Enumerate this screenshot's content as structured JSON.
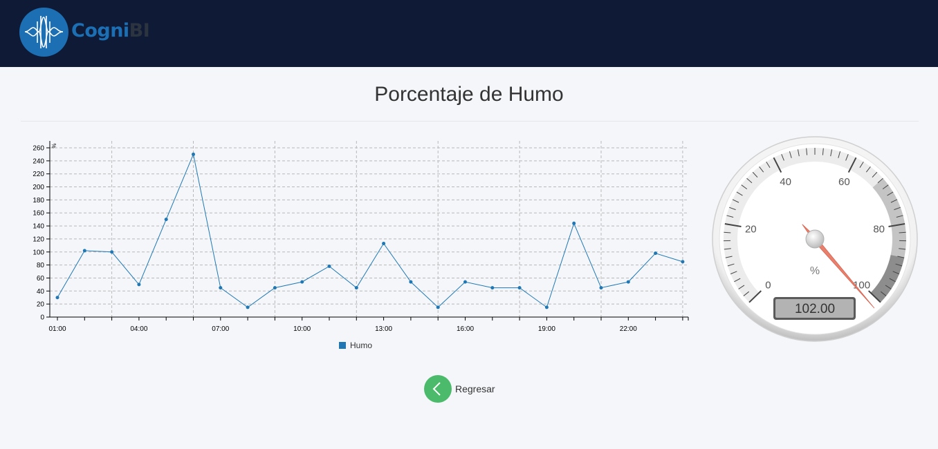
{
  "brand": {
    "part1": "Cogni",
    "part2": "BI",
    "primary": "#1d6fb4",
    "dark_bg": "#0e1a36"
  },
  "page": {
    "title": "Porcentaje de Humo"
  },
  "chart_data": {
    "type": "line",
    "x": [
      "01:00",
      "02:00",
      "03:00",
      "04:00",
      "05:00",
      "06:00",
      "07:00",
      "08:00",
      "09:00",
      "10:00",
      "11:00",
      "12:00",
      "13:00",
      "14:00",
      "15:00",
      "16:00",
      "17:00",
      "18:00",
      "19:00",
      "20:00",
      "21:00",
      "22:00",
      "23:00",
      "24:00"
    ],
    "x_tick_labels": [
      "01:00",
      "04:00",
      "07:00",
      "10:00",
      "13:00",
      "16:00",
      "19:00",
      "22:00"
    ],
    "series": [
      {
        "name": "Humo",
        "color": "#1f77b4",
        "values": [
          30,
          102,
          100,
          50,
          150,
          250,
          45,
          15,
          45,
          54,
          78,
          45,
          113,
          54,
          15,
          54,
          45,
          45,
          15,
          144,
          45,
          54,
          98,
          85
        ]
      }
    ],
    "ylabel": "%",
    "ylim": [
      0,
      260
    ],
    "yticks": [
      0,
      20,
      40,
      60,
      80,
      100,
      120,
      140,
      160,
      180,
      200,
      220,
      240,
      260
    ],
    "grid": true,
    "legend": "bottom-center"
  },
  "gauge": {
    "value": 102,
    "display": "102.00",
    "unit": "%",
    "min": 0,
    "max": 100,
    "labels": [
      "0",
      "20",
      "40",
      "60",
      "80",
      "100"
    ]
  },
  "back_button": {
    "label": "Regresar",
    "color": "#4cba6b"
  }
}
